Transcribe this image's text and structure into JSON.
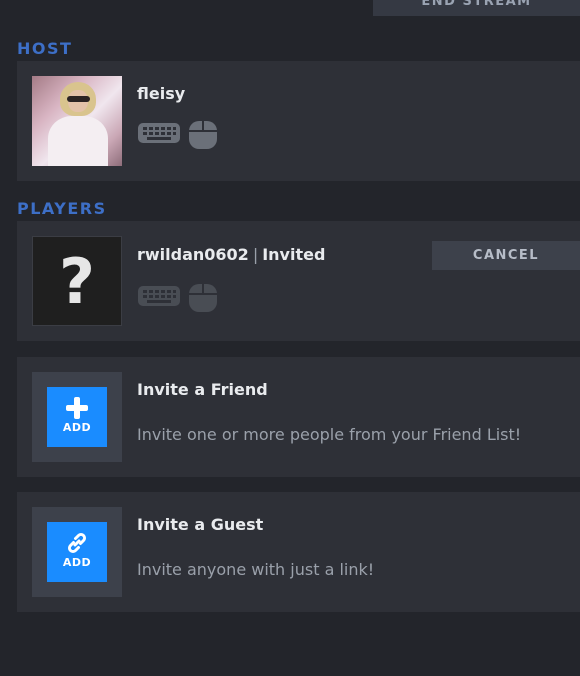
{
  "top_bar": {
    "end_stream_label": "END STREAM"
  },
  "host": {
    "section_title": "HOST",
    "name": "fleisy",
    "icons": [
      "keyboard-icon",
      "mouse-icon"
    ]
  },
  "players": {
    "section_title": "PLAYERS",
    "invited": {
      "name": "rwildan0602",
      "separator": "|",
      "status": "Invited",
      "avatar_glyph": "?",
      "cancel_label": "CANCEL",
      "icons": [
        "keyboard-icon",
        "mouse-icon"
      ]
    }
  },
  "invite_friend": {
    "title": "Invite a Friend",
    "description": "Invite one or more people from your Friend List!",
    "button_label": "ADD",
    "icon": "plus-icon"
  },
  "invite_guest": {
    "title": "Invite a Guest",
    "description": "Invite anyone with just a link!",
    "button_label": "ADD",
    "icon": "link-icon"
  },
  "colors": {
    "background": "#23252b",
    "panel": "#2e3037",
    "section_title": "#3d6fc7",
    "add_button": "#1a8cff",
    "cancel_button": "#3d414b"
  }
}
